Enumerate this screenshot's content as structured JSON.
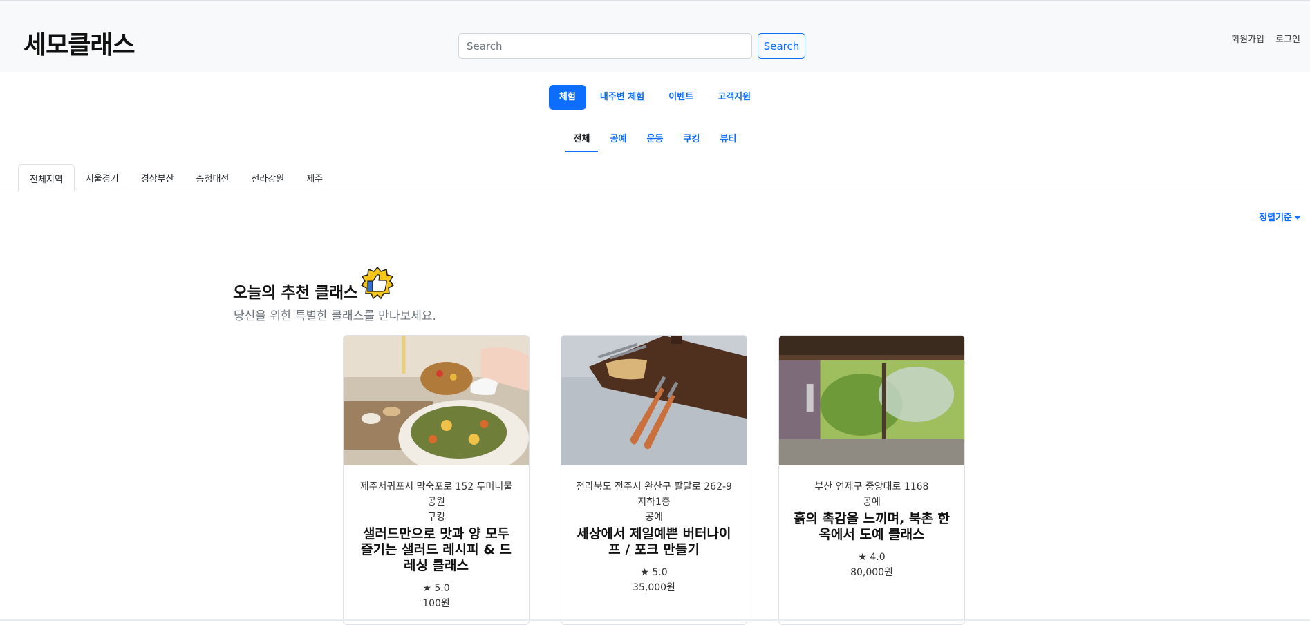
{
  "header": {
    "logo": "세모클래스",
    "search_placeholder": "Search",
    "search_button": "Search",
    "signup": "회원가입",
    "login": "로그인"
  },
  "main_nav": {
    "items": [
      "체험",
      "내주변 체험",
      "이벤트",
      "고객지원"
    ],
    "active": "체험"
  },
  "sub_nav": {
    "items": [
      "전체",
      "공예",
      "운동",
      "쿠킹",
      "뷰티"
    ],
    "active": "전체"
  },
  "region_tabs": {
    "items": [
      "전체지역",
      "서울경기",
      "경상부산",
      "충청대전",
      "전라강원",
      "제주"
    ],
    "active": "전체지역"
  },
  "sort": {
    "label": "정렬기준"
  },
  "recommend": {
    "title": "오늘의 추천 클래스",
    "subtitle": "당신을 위한 특별한 클래스를 만나보세요."
  },
  "cards": [
    {
      "address": "제주서귀포시 막숙포로 152 두머니물 공원",
      "category": "쿠킹",
      "title": "샐러드만으로 맛과 양 모두 즐기는 샐러드 레시피 & 드레싱 클래스",
      "rating": "★ 5.0",
      "price": "100원"
    },
    {
      "address": "전라북도 전주시 완산구 팔달로 262-9 지하1층",
      "category": "공예",
      "title": "세상에서 제일예쁜 버터나이프 / 포크 만들기",
      "rating": "★ 5.0",
      "price": "35,000원"
    },
    {
      "address": "부산 연제구 중앙대로 1168",
      "category": "공예",
      "title": "흙의 촉감을 느끼며, 북촌 한옥에서 도예 클래스",
      "rating": "★ 4.0",
      "price": "80,000원"
    }
  ],
  "colors": {
    "primary": "#0d6efd",
    "header_bg": "#f8f9fa"
  }
}
